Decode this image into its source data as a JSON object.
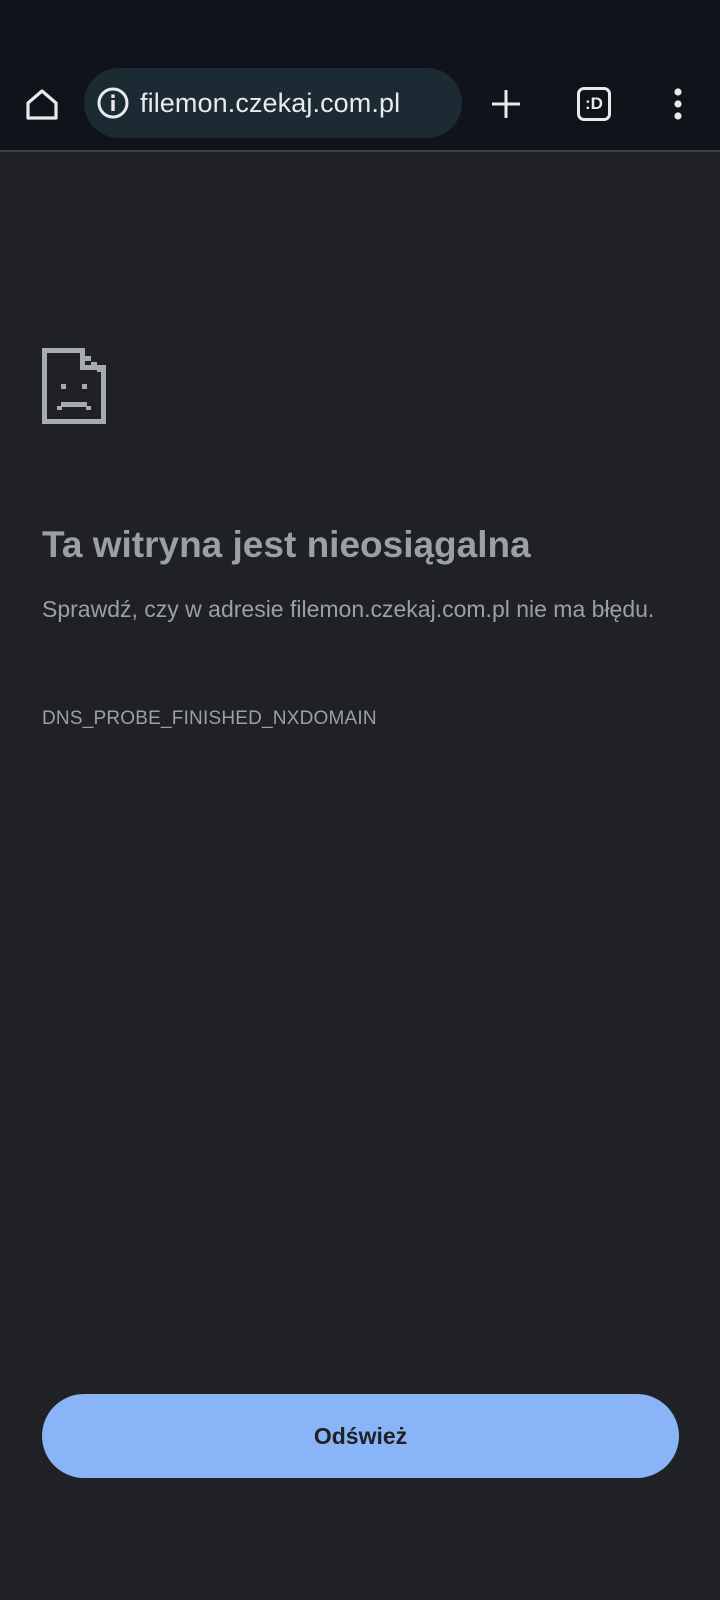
{
  "toolbar": {
    "url": "filemon.czekaj.com.pl",
    "tab_switcher_label": ":D",
    "icons": {
      "home": "home-icon",
      "info": "info-icon",
      "new_tab": "plus-icon",
      "tabs": "tab-switcher-icon",
      "menu": "more-vert-icon"
    }
  },
  "error_page": {
    "icon": "sad-page-icon",
    "heading": "Ta witryna jest nieosiągalna",
    "description": "Sprawdź, czy w adresie filemon.czekaj.com.pl nie ma błędu.",
    "error_code": "DNS_PROBE_FINISHED_NXDOMAIN",
    "reload_label": "Odśwież"
  },
  "colors": {
    "toolbar_bg": "#0f131a",
    "omnibox_bg": "#1c2a33",
    "page_bg": "#202124",
    "text_muted": "#9aa0a6",
    "button_bg": "#8ab4f8",
    "button_text": "#202124"
  }
}
